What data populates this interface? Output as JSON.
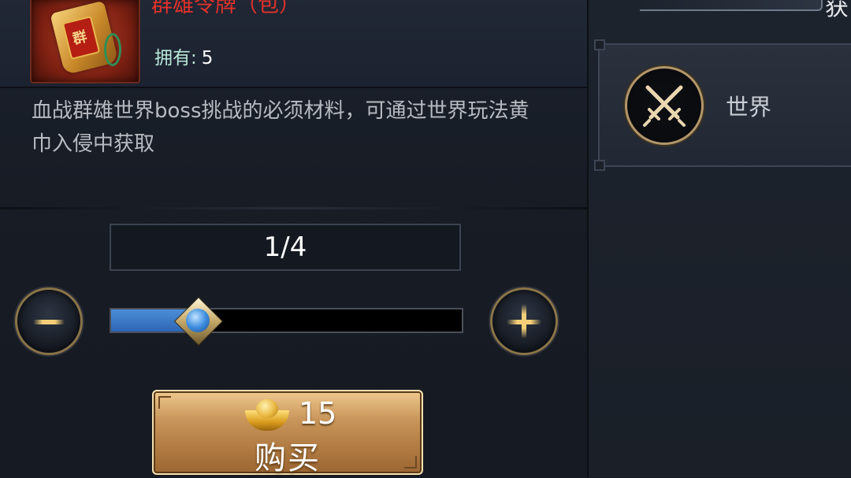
{
  "item": {
    "title": "群雄令牌（包）",
    "owned_label": "拥有:",
    "owned_count": "5",
    "seal_char": "群",
    "description": "血战群雄世界boss挑战的必须材料，可通过世界玩法黄巾入侵中获取"
  },
  "quantity": {
    "display": "1/4",
    "current": 1,
    "max": 4,
    "fill_fraction": 0.25
  },
  "buy": {
    "price": "15",
    "label": "购买",
    "currency_icon": "gold-ingot-icon"
  },
  "sources": {
    "title": "获",
    "items": [
      {
        "label": "世界",
        "icon": "crossed-swords-icon"
      }
    ]
  },
  "colors": {
    "title_red": "#e0322a",
    "owned_green": "#b9e8d8",
    "slider_blue": "#3c7cc9",
    "gold": "#f4cf78"
  }
}
